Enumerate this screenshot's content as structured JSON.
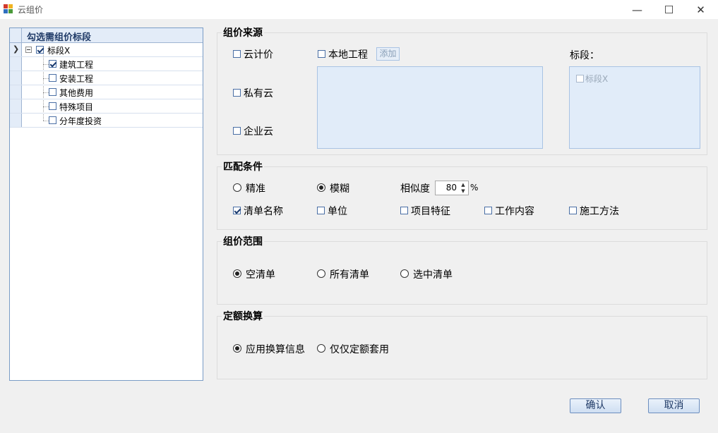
{
  "window": {
    "title": "云组价",
    "minimize": "—",
    "maximize": "☐",
    "close": "✕"
  },
  "tree": {
    "header": "勾选需组价标段",
    "root": {
      "label": "标段X",
      "checked": true
    },
    "children": [
      {
        "label": "建筑工程",
        "checked": true
      },
      {
        "label": "安装工程",
        "checked": false
      },
      {
        "label": "其他费用",
        "checked": false
      },
      {
        "label": "特殊项目",
        "checked": false
      },
      {
        "label": "分年度投资",
        "checked": false
      }
    ]
  },
  "source": {
    "title": "组价来源",
    "cloud_price": "云计价",
    "private_cloud": "私有云",
    "enterprise_cloud": "企业云",
    "local_project": "本地工程",
    "add_button": "添加",
    "section_label": "标段：",
    "section_item": "标段X"
  },
  "match": {
    "title": "匹配条件",
    "exact": "精准",
    "fuzzy": "模糊",
    "selected_mode": "模糊",
    "similarity_label": "相似度",
    "similarity_value": "80",
    "percent": "%",
    "list_name": "清单名称",
    "unit": "单位",
    "feature": "项目特征",
    "work_content": "工作内容",
    "method": "施工方法"
  },
  "scope": {
    "title": "组价范围",
    "empty_list": "空清单",
    "all_lists": "所有清单",
    "selected_list": "选中清单",
    "selected": "空清单"
  },
  "quota": {
    "title": "定额换算",
    "apply_info": "应用换算信息",
    "only_apply": "仅仅定额套用",
    "selected": "应用换算信息"
  },
  "buttons": {
    "confirm": "确认",
    "cancel": "取消"
  }
}
